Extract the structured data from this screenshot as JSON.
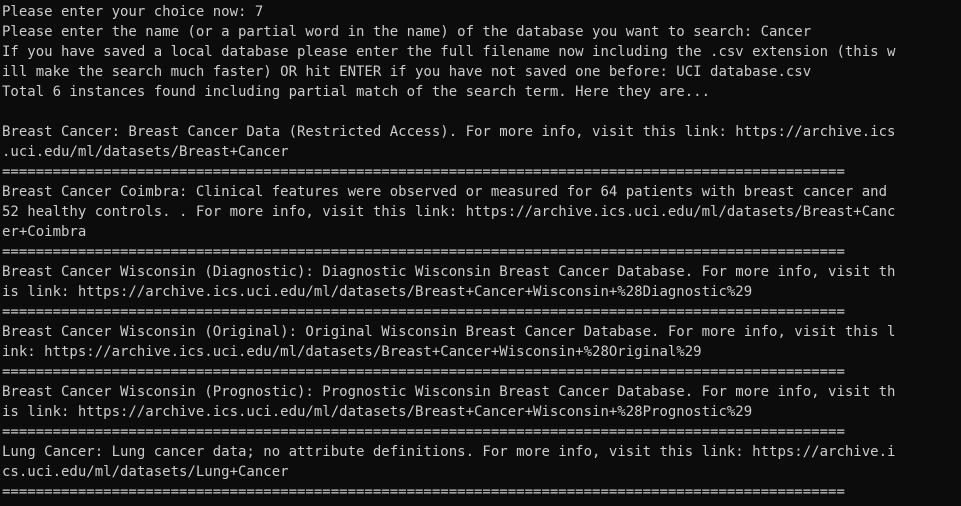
{
  "colors": {
    "background": "#0c0c0c",
    "foreground": "#cccccc"
  },
  "console": {
    "lines": [
      "Please enter your choice now: 7",
      "Please enter the name (or a partial word in the name) of the database you want to search: Cancer",
      "If you have saved a local database please enter the full filename now including the .csv extension (this w",
      "ill make the search much faster) OR hit ENTER if you have not saved one before: UCI database.csv",
      "Total 6 instances found including partial match of the search term. Here they are...",
      "",
      "Breast Cancer: Breast Cancer Data (Restricted Access). For more info, visit this link: https://archive.ics",
      ".uci.edu/ml/datasets/Breast+Cancer",
      "====================================================================================================",
      "Breast Cancer Coimbra: Clinical features were observed or measured for 64 patients with breast cancer and",
      "52 healthy controls. . For more info, visit this link: https://archive.ics.uci.edu/ml/datasets/Breast+Canc",
      "er+Coimbra",
      "====================================================================================================",
      "Breast Cancer Wisconsin (Diagnostic): Diagnostic Wisconsin Breast Cancer Database. For more info, visit th",
      "is link: https://archive.ics.uci.edu/ml/datasets/Breast+Cancer+Wisconsin+%28Diagnostic%29",
      "====================================================================================================",
      "Breast Cancer Wisconsin (Original): Original Wisconsin Breast Cancer Database. For more info, visit this l",
      "ink: https://archive.ics.uci.edu/ml/datasets/Breast+Cancer+Wisconsin+%28Original%29",
      "====================================================================================================",
      "Breast Cancer Wisconsin (Prognostic): Prognostic Wisconsin Breast Cancer Database. For more info, visit th",
      "is link: https://archive.ics.uci.edu/ml/datasets/Breast+Cancer+Wisconsin+%28Prognostic%29",
      "====================================================================================================",
      "Lung Cancer: Lung cancer data; no attribute definitions. For more info, visit this link: https://archive.i",
      "cs.uci.edu/ml/datasets/Lung+Cancer",
      "===================================================================================================="
    ]
  }
}
